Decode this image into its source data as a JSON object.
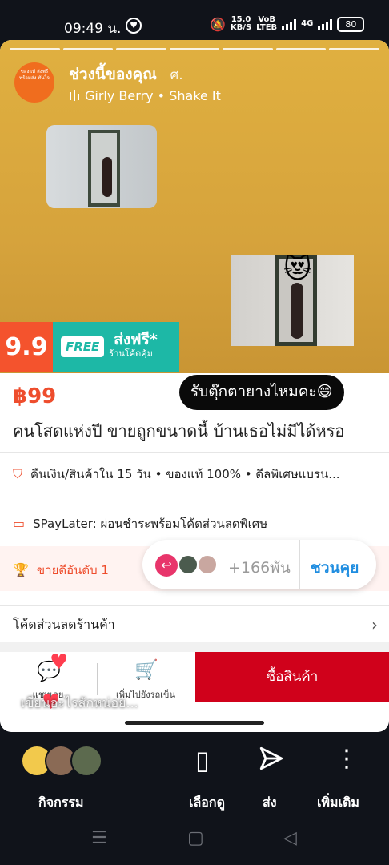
{
  "status": {
    "time": "09:49 น.",
    "net_speed": "15.0",
    "net_unit": "KB/S",
    "volte": "VoB LTEB",
    "signal": "4G",
    "battery": "80"
  },
  "story": {
    "title": "ช่วงนี้ของคุณ",
    "when": "ศ.",
    "music": "Girly Berry • Shake It",
    "avatar_text": "ของแท้ ส่งฟรี พร้อมส่ง ทันใจ",
    "sticker_emoji": "😻"
  },
  "banner": {
    "sale_tag": "9.9",
    "free_badge": "FREE",
    "free_title": "ส่งฟรี*",
    "free_subtitle": "ร้านโค้ดคุ้ม"
  },
  "product": {
    "price": "฿99",
    "sticker_text": "รับตุ๊กตายางไหมคะ😄",
    "name": "คนโสดแห่งปี ขายถูกขนาดนี้ บ้านเธอไม่มีได้หรอ",
    "guarantee": "คืนเงิน/สินค้าใน 15 วัน  •  ของแท้ 100%  •  ดีลพิเศษแบรน...",
    "spaylater": "SPayLater: ผ่อนชำระพร้อมโค้ดส่วนลดพิเศษ",
    "best_seller": "ขายดีอันดับ 1",
    "shop_voucher": "โค้ดส่วนลดร้านค้า"
  },
  "chat": {
    "viewer_count": "+166พัน",
    "invite_label": "ชวนคุย"
  },
  "bottom": {
    "chat_label": "แชทเลย",
    "cart_label": "เพิ่มไปยังรถเข็น",
    "buy_label": "ซื้อสินค้า",
    "comment_placeholder": "เขียนอะไรสักหน่อย..."
  },
  "actions": {
    "activity": "กิจกรรม",
    "browse": "เลือกดู",
    "send": "ส่ง",
    "more": "เพิ่มเติม"
  },
  "colors": {
    "accent": "#ee4d2d",
    "buy_button": "#d0011b",
    "invite": "#1f8de0"
  }
}
